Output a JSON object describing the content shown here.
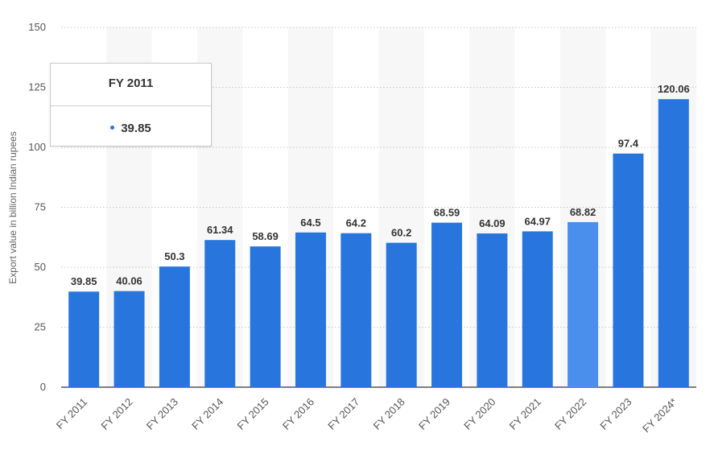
{
  "chart_data": {
    "type": "bar",
    "title": "",
    "xlabel": "",
    "ylabel": "Export value in billion Indian rupees",
    "ylim": [
      0,
      150
    ],
    "yticks": [
      0,
      25,
      50,
      75,
      100,
      125,
      150
    ],
    "categories": [
      "FY 2011",
      "FY 2012",
      "FY 2013",
      "FY 2014",
      "FY 2015",
      "FY 2016",
      "FY 2017",
      "FY 2018",
      "FY 2019",
      "FY 2020",
      "FY 2021",
      "FY 2022",
      "FY 2023",
      "FY 2024*"
    ],
    "values": [
      39.85,
      40.06,
      50.3,
      61.34,
      58.69,
      64.5,
      64.2,
      60.2,
      68.59,
      64.09,
      64.97,
      68.82,
      97.4,
      120.06
    ],
    "data_labels": [
      "39.85",
      "40.06",
      "50.3",
      "61.34",
      "58.69",
      "64.5",
      "64.2",
      "60.2",
      "68.59",
      "64.09",
      "64.97",
      "68.82",
      "97.4",
      "120.06"
    ],
    "grid": true,
    "highlighted_index": 11,
    "colors": {
      "bar": "#2876dd",
      "bar_highlight": "#4a8fec",
      "band": "#f7f7f7"
    }
  },
  "tooltip": {
    "title": "FY 2011",
    "value": "39.85"
  }
}
